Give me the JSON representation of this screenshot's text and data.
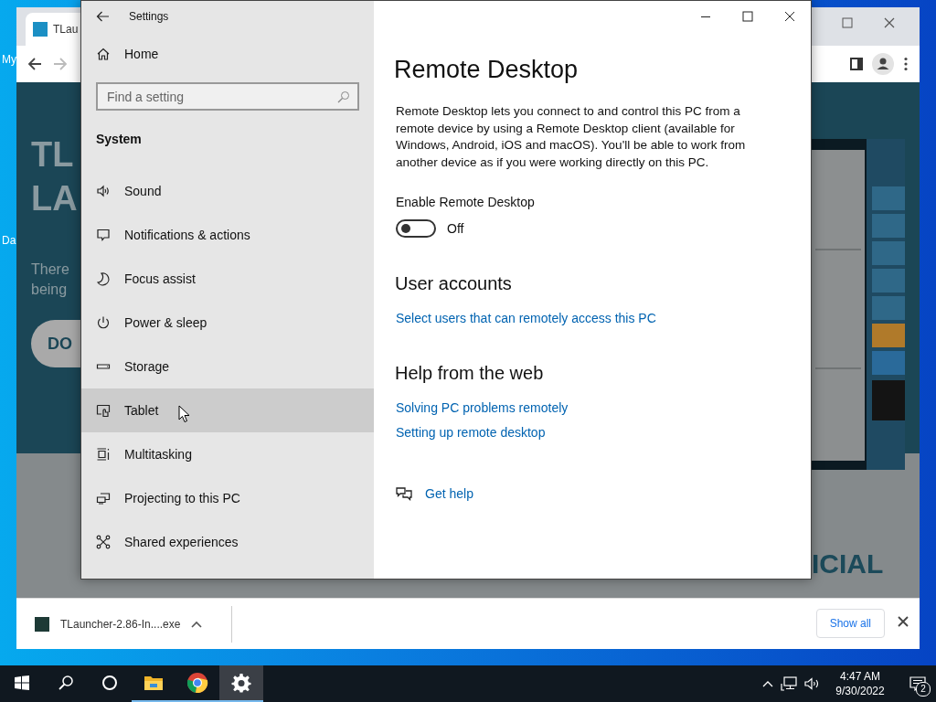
{
  "desktop": {
    "icons": [
      {
        "label": "My"
      },
      {
        "label": "Da"
      }
    ]
  },
  "browser": {
    "tab_title": "TLau",
    "page": {
      "headline": [
        "TL",
        "LA"
      ],
      "intro": [
        "There",
        "being"
      ],
      "download_button": "DO",
      "lower_headline": [
        "ICIAL"
      ]
    }
  },
  "downloads": {
    "file_name": "TLauncher-2.86-In....exe",
    "show_all": "Show all"
  },
  "settings": {
    "title": "Settings",
    "home": "Home",
    "search": {
      "placeholder": "Find a setting"
    },
    "section": "System",
    "items": [
      {
        "label": "Sound",
        "kind": "sound",
        "hovered": false
      },
      {
        "label": "Notifications & actions",
        "kind": "notifications",
        "hovered": false
      },
      {
        "label": "Focus assist",
        "kind": "focus",
        "hovered": false
      },
      {
        "label": "Power & sleep",
        "kind": "power",
        "hovered": false
      },
      {
        "label": "Storage",
        "kind": "storage",
        "hovered": false
      },
      {
        "label": "Tablet",
        "kind": "tablet",
        "hovered": true
      },
      {
        "label": "Multitasking",
        "kind": "multitasking",
        "hovered": false
      },
      {
        "label": "Projecting to this PC",
        "kind": "projecting",
        "hovered": false
      },
      {
        "label": "Shared experiences",
        "kind": "shared",
        "hovered": false
      }
    ],
    "page": {
      "title": "Remote Desktop",
      "description": "Remote Desktop lets you connect to and control this PC from a remote device by using a Remote Desktop client (available for Windows, Android, iOS and macOS). You'll be able to work from another device as if you were working directly on this PC.",
      "toggle": {
        "label": "Enable Remote Desktop",
        "on": false,
        "state_text": "Off"
      },
      "sections": [
        {
          "title": "User accounts",
          "links": [
            "Select users that can remotely access this PC"
          ]
        },
        {
          "title": "Help from the web",
          "links": [
            "Solving PC problems remotely",
            "Setting up remote desktop"
          ]
        }
      ],
      "get_help": "Get help"
    }
  },
  "taskbar": {
    "apps": [
      {
        "kind": "start",
        "running": false,
        "selected": false
      },
      {
        "kind": "search",
        "running": false,
        "selected": false
      },
      {
        "kind": "cortana",
        "running": false,
        "selected": false
      },
      {
        "kind": "explorer",
        "running": true,
        "selected": false
      },
      {
        "kind": "chrome",
        "running": true,
        "selected": false
      },
      {
        "kind": "settings",
        "running": true,
        "selected": true
      }
    ],
    "time": "4:47 AM",
    "date": "9/30/2022",
    "notification_count": "2"
  }
}
